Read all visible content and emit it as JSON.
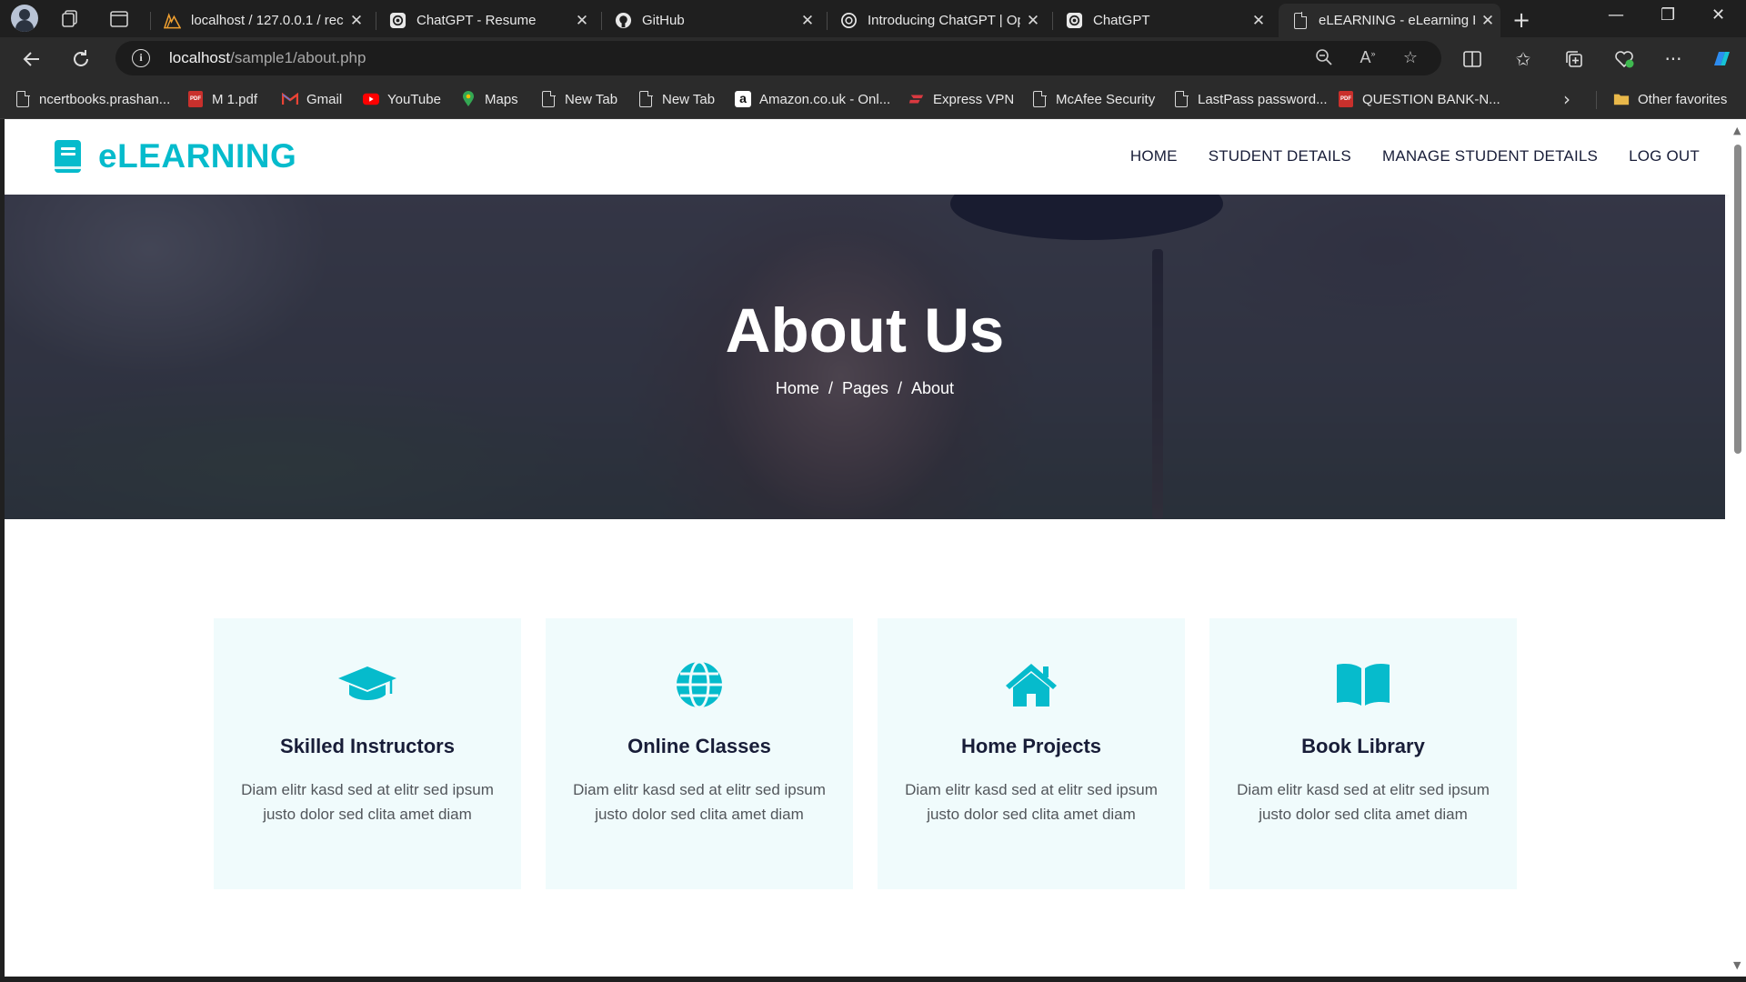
{
  "browser": {
    "tabs": [
      {
        "title": "localhost / 127.0.0.1 / rec",
        "favicon": "phpmyadmin-icon",
        "active": false
      },
      {
        "title": "ChatGPT - Resume",
        "favicon": "openai-icon",
        "active": false
      },
      {
        "title": "GitHub",
        "favicon": "github-icon",
        "active": false
      },
      {
        "title": "Introducing ChatGPT | Op",
        "favicon": "openai-icon",
        "active": false
      },
      {
        "title": "ChatGPT",
        "favicon": "openai-icon",
        "active": false
      },
      {
        "title": "eLEARNING - eLearning H",
        "favicon": "page-icon",
        "active": true
      }
    ],
    "address": {
      "host": "localhost",
      "path": "/sample1/about.php"
    },
    "bookmarks": [
      {
        "label": "ncertbooks.prashan...",
        "icon": "page-icon"
      },
      {
        "label": "M 1.pdf",
        "icon": "pdf-icon"
      },
      {
        "label": "Gmail",
        "icon": "gmail-icon"
      },
      {
        "label": "YouTube",
        "icon": "youtube-icon"
      },
      {
        "label": "Maps",
        "icon": "maps-icon"
      },
      {
        "label": "New Tab",
        "icon": "page-icon"
      },
      {
        "label": "New Tab",
        "icon": "page-icon"
      },
      {
        "label": "Amazon.co.uk - Onl...",
        "icon": "amazon-icon"
      },
      {
        "label": "Express VPN",
        "icon": "expressvpn-icon"
      },
      {
        "label": "McAfee Security",
        "icon": "page-icon"
      },
      {
        "label": "LastPass password...",
        "icon": "page-icon"
      },
      {
        "label": "QUESTION BANK-N...",
        "icon": "pdf-icon"
      }
    ],
    "other_favorites": "Other favorites"
  },
  "site": {
    "brand": "eLEARNING",
    "accent_color": "#06bbcc",
    "nav": [
      "HOME",
      "STUDENT DETAILS",
      "MANAGE STUDENT DETAILS",
      "LOG OUT"
    ],
    "hero": {
      "title": "About Us",
      "breadcrumb": [
        "Home",
        "Pages",
        "About"
      ]
    },
    "features": [
      {
        "icon": "graduation-cap-icon",
        "title": "Skilled Instructors",
        "text": "Diam elitr kasd sed at elitr sed ipsum justo dolor sed clita amet diam"
      },
      {
        "icon": "globe-icon",
        "title": "Online Classes",
        "text": "Diam elitr kasd sed at elitr sed ipsum justo dolor sed clita amet diam"
      },
      {
        "icon": "home-icon",
        "title": "Home Projects",
        "text": "Diam elitr kasd sed at elitr sed ipsum justo dolor sed clita amet diam"
      },
      {
        "icon": "book-open-icon",
        "title": "Book Library",
        "text": "Diam elitr kasd sed at elitr sed ipsum justo dolor sed clita amet diam"
      }
    ]
  }
}
